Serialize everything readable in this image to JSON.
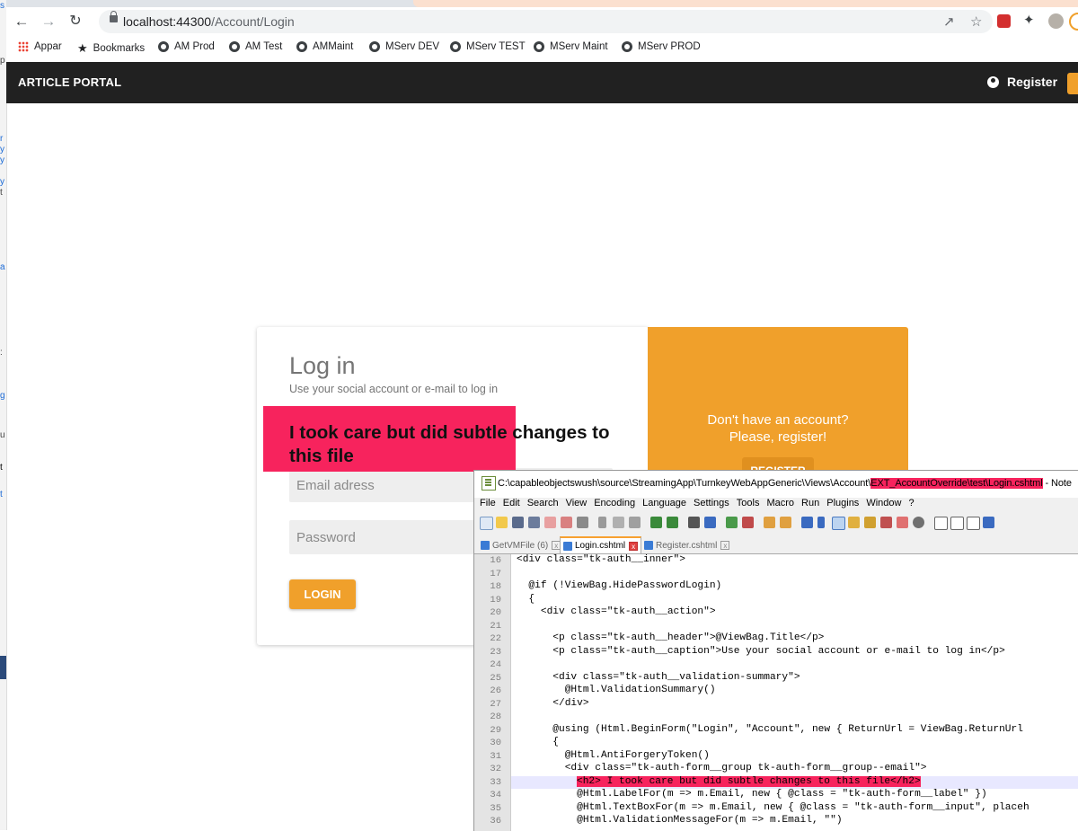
{
  "browser": {
    "url_host": "localhost:44300",
    "url_path": "/Account/Login",
    "bookmarks": [
      {
        "label": "Appar",
        "icon": "apps-grid-icon"
      },
      {
        "label": "Bookmarks",
        "icon": "star-icon"
      },
      {
        "label": "AM Prod",
        "icon": "globe-icon"
      },
      {
        "label": "AM Test",
        "icon": "globe-icon"
      },
      {
        "label": "AMMaint",
        "icon": "globe-icon"
      },
      {
        "label": "MServ DEV",
        "icon": "globe-icon"
      },
      {
        "label": "MServ TEST",
        "icon": "globe-icon"
      },
      {
        "label": "MServ Maint",
        "icon": "globe-icon"
      },
      {
        "label": "MServ PROD",
        "icon": "globe-icon"
      }
    ]
  },
  "app": {
    "brand": "ARTICLE PORTAL",
    "nav_register": "Register",
    "accent": "#f0a02b",
    "nav_bg": "#212121"
  },
  "login": {
    "title": "Log in",
    "caption": "Use your social account or e-mail to log in",
    "email_placeholder": "Email adress",
    "password_placeholder": "Password",
    "button": "LOGIN"
  },
  "register_panel": {
    "line1": "Don't have an account?",
    "line2": "Please, register!",
    "button": "REGISTER"
  },
  "injected_heading": "I took care but did subtle changes to this file",
  "highlight_color": "#f7235d",
  "editor": {
    "path_prefix": "C:\\capableobjectswush\\source\\StreamingApp\\TurnkeyWebAppGeneric\\Views\\Account\\",
    "path_highlight": "EXT_AccountOverride\\test\\Login.cshtml",
    "path_suffix": " - Note",
    "menu": [
      "File",
      "Edit",
      "Search",
      "View",
      "Encoding",
      "Language",
      "Settings",
      "Tools",
      "Macro",
      "Run",
      "Plugins",
      "Window",
      "?"
    ],
    "tabs": [
      {
        "label": "GetVMFile (6)",
        "active": false
      },
      {
        "label": "Login.cshtml",
        "active": true
      },
      {
        "label": "Register.cshtml",
        "active": false
      }
    ],
    "lines": [
      {
        "n": "16",
        "text": "<div class=\"tk-auth__inner\">"
      },
      {
        "n": "17",
        "text": ""
      },
      {
        "n": "18",
        "text": "  @if (!ViewBag.HidePasswordLogin)"
      },
      {
        "n": "19",
        "text": "  {"
      },
      {
        "n": "20",
        "text": "    <div class=\"tk-auth__action\">"
      },
      {
        "n": "21",
        "text": ""
      },
      {
        "n": "22",
        "text": "      <p class=\"tk-auth__header\">@ViewBag.Title</p>"
      },
      {
        "n": "23",
        "text": "      <p class=\"tk-auth__caption\">Use your social account or e-mail to log in</p>"
      },
      {
        "n": "24",
        "text": ""
      },
      {
        "n": "25",
        "text": "      <div class=\"tk-auth__validation-summary\">"
      },
      {
        "n": "26",
        "text": "        @Html.ValidationSummary()"
      },
      {
        "n": "27",
        "text": "      </div>"
      },
      {
        "n": "28",
        "text": ""
      },
      {
        "n": "29",
        "text": "      @using (Html.BeginForm(\"Login\", \"Account\", new { ReturnUrl = ViewBag.ReturnUrl"
      },
      {
        "n": "30",
        "text": "      {"
      },
      {
        "n": "31",
        "text": "        @Html.AntiForgeryToken()"
      },
      {
        "n": "32",
        "text": "        <div class=\"tk-auth-form__group tk-auth-form__group--email\">"
      },
      {
        "n": "33",
        "text": "          <h2> I took care but did subtle changes to this file</h2>"
      },
      {
        "n": "34",
        "text": "          @Html.LabelFor(m => m.Email, new { @class = \"tk-auth-form__label\" })"
      },
      {
        "n": "35",
        "text": "          @Html.TextBoxFor(m => m.Email, new { @class = \"tk-auth-form__input\", placeh"
      },
      {
        "n": "36",
        "text": "          @Html.ValidationMessageFor(m => m.Email, \"\")"
      }
    ]
  }
}
